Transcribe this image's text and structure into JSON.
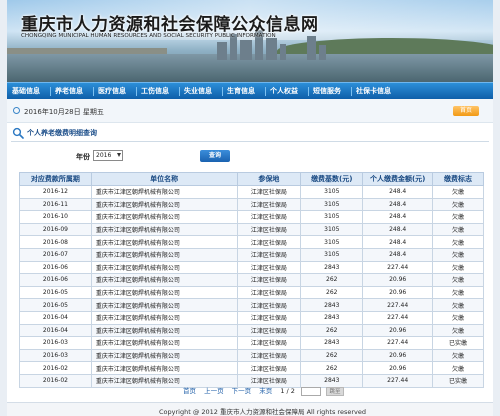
{
  "header": {
    "title": "重庆市人力资源和社会保障公众信息网",
    "subtitle": "CHONGQING MUNICIPAL HUMAN RESOURCES AND SOCIAL SECURITY PUBLIC INFORMATION"
  },
  "nav": {
    "items": [
      "基础信息",
      "养老信息",
      "医疗信息",
      "工伤信息",
      "失业信息",
      "生育信息",
      "个人权益",
      "短信服务",
      "社保卡信息"
    ]
  },
  "datebar": {
    "date": "2016年10月28日 星期五",
    "home_label": "首页"
  },
  "section": {
    "title": "个人养老缴费明细查询"
  },
  "filter": {
    "year_label": "年份",
    "year_value": "2016",
    "query_label": "查询"
  },
  "table": {
    "headers": [
      "对应费款所属期",
      "单位名称",
      "参保地",
      "缴费基数(元)",
      "个人缴费金额(元)",
      "缴费标志"
    ],
    "rows": [
      [
        "2016-12",
        "重庆市江津区朝焊机械有限公司",
        "江津区社保局",
        "3105",
        "248.4",
        "欠缴"
      ],
      [
        "2016-11",
        "重庆市江津区朝焊机械有限公司",
        "江津区社保局",
        "3105",
        "248.4",
        "欠缴"
      ],
      [
        "2016-10",
        "重庆市江津区朝焊机械有限公司",
        "江津区社保局",
        "3105",
        "248.4",
        "欠缴"
      ],
      [
        "2016-09",
        "重庆市江津区朝焊机械有限公司",
        "江津区社保局",
        "3105",
        "248.4",
        "欠缴"
      ],
      [
        "2016-08",
        "重庆市江津区朝焊机械有限公司",
        "江津区社保局",
        "3105",
        "248.4",
        "欠缴"
      ],
      [
        "2016-07",
        "重庆市江津区朝焊机械有限公司",
        "江津区社保局",
        "3105",
        "248.4",
        "欠缴"
      ],
      [
        "2016-06",
        "重庆市江津区朝焊机械有限公司",
        "江津区社保局",
        "2843",
        "227.44",
        "欠缴"
      ],
      [
        "2016-06",
        "重庆市江津区朝焊机械有限公司",
        "江津区社保局",
        "262",
        "20.96",
        "欠缴"
      ],
      [
        "2016-05",
        "重庆市江津区朝焊机械有限公司",
        "江津区社保局",
        "262",
        "20.96",
        "欠缴"
      ],
      [
        "2016-05",
        "重庆市江津区朝焊机械有限公司",
        "江津区社保局",
        "2843",
        "227.44",
        "欠缴"
      ],
      [
        "2016-04",
        "重庆市江津区朝焊机械有限公司",
        "江津区社保局",
        "2843",
        "227.44",
        "欠缴"
      ],
      [
        "2016-04",
        "重庆市江津区朝焊机械有限公司",
        "江津区社保局",
        "262",
        "20.96",
        "欠缴"
      ],
      [
        "2016-03",
        "重庆市江津区朝焊机械有限公司",
        "江津区社保局",
        "2843",
        "227.44",
        "已实缴"
      ],
      [
        "2016-03",
        "重庆市江津区朝焊机械有限公司",
        "江津区社保局",
        "262",
        "20.96",
        "欠缴"
      ],
      [
        "2016-02",
        "重庆市江津区朝焊机械有限公司",
        "江津区社保局",
        "262",
        "20.96",
        "欠缴"
      ],
      [
        "2016-02",
        "重庆市江津区朝焊机械有限公司",
        "江津区社保局",
        "2843",
        "227.44",
        "已实缴"
      ]
    ]
  },
  "pager": {
    "first": "首页",
    "prev": "上一页",
    "next": "下一页",
    "last": "末页",
    "page_info": "1 / 2",
    "jump_label": "跳至"
  },
  "footer": {
    "copyright": "Copyright @ 2012 重庆市人力资源和社会保障局 All rights reserved"
  },
  "colors": {
    "nav_blue": "#1a72c2",
    "header_blue": "#1a4a83",
    "accent_orange": "#f29a14"
  }
}
